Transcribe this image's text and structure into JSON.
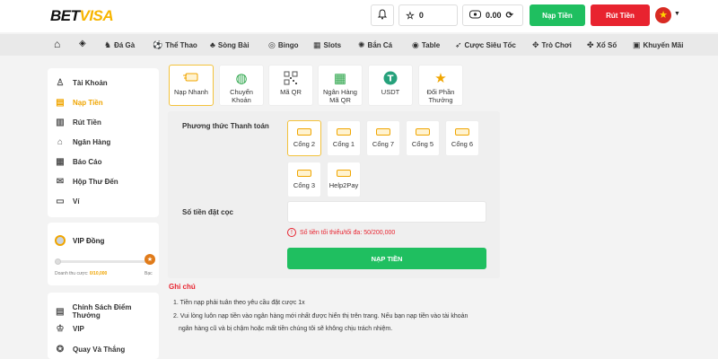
{
  "header": {
    "logo_part1": "BET",
    "logo_part2": "VISA",
    "points": "0",
    "balance": "0.00",
    "deposit_label": "Nạp Tiền",
    "withdraw_label": "Rút Tiền",
    "flag_star": "★",
    "brand_colors": {
      "deposit": "#1fbf60",
      "withdraw": "#e8232f",
      "accent": "#f0a500"
    }
  },
  "nav": {
    "items": [
      {
        "label": "Đá Gà",
        "icon": "rooster-icon"
      },
      {
        "label": "Thể Thao",
        "icon": "soccer-ball-icon"
      },
      {
        "label": "Sòng Bài",
        "icon": "casino-chip-icon"
      },
      {
        "label": "Bingo",
        "icon": "bingo-icon"
      },
      {
        "label": "Slots",
        "icon": "slot-machine-icon"
      },
      {
        "label": "Bắn Cá",
        "icon": "fish-icon"
      },
      {
        "label": "Table",
        "icon": "table-icon"
      },
      {
        "label": "Cược Siêu Tốc",
        "icon": "fast-bet-icon"
      },
      {
        "label": "Trò Chơi",
        "icon": "gamepad-icon"
      },
      {
        "label": "Xổ Số",
        "icon": "lottery-icon"
      },
      {
        "label": "Khuyến Mãi",
        "icon": "gift-icon"
      }
    ]
  },
  "sidebar": {
    "account": [
      {
        "label": "Tài Khoản",
        "icon": "user-icon"
      },
      {
        "label": "Nạp Tiền",
        "icon": "deposit-icon",
        "active": true
      },
      {
        "label": "Rút Tiền",
        "icon": "withdraw-icon"
      },
      {
        "label": "Ngân Hàng",
        "icon": "bank-icon"
      },
      {
        "label": "Báo Cáo",
        "icon": "report-icon"
      },
      {
        "label": "Hộp Thư Đến",
        "icon": "mail-icon"
      },
      {
        "label": "Ví",
        "icon": "wallet-icon"
      }
    ],
    "vip": {
      "title": "VIP Đồng",
      "turnover_label": "Doanh thu cược:",
      "turnover_value": "0/10,000",
      "next_level": "Bạc",
      "progress": 0
    },
    "more": [
      {
        "label": "Chính Sách Điểm Thưởng",
        "icon": "policy-icon"
      },
      {
        "label": "VIP",
        "icon": "crown-icon"
      },
      {
        "label": "Quay Và Thắng",
        "icon": "spin-icon"
      }
    ]
  },
  "methods": [
    {
      "label": "Nạp Nhanh",
      "icon": "card-icon",
      "active": true
    },
    {
      "label": "Chuyển Khoản",
      "icon": "globe-icon"
    },
    {
      "label": "Mã QR",
      "icon": "qr-icon"
    },
    {
      "label": "Ngân Hàng Mã QR",
      "icon": "bank-qr-icon"
    },
    {
      "label": "USDT",
      "icon": "usdt-icon"
    },
    {
      "label": "Đổi Phần Thưởng",
      "icon": "star-icon"
    }
  ],
  "form": {
    "payment_label": "Phương thức Thanh toán",
    "gates": [
      {
        "label": "Cổng 2",
        "active": true
      },
      {
        "label": "Cổng 1"
      },
      {
        "label": "Cổng 7"
      },
      {
        "label": "Cổng 5"
      },
      {
        "label": "Cổng 6"
      },
      {
        "label": "Cổng 3"
      },
      {
        "label": "Help2Pay"
      }
    ],
    "amount_label": "Số tiền đặt cọc",
    "amount_value": "",
    "error_text": "Số tiền tối thiểu/tối đa: 50/200,000",
    "submit_label": "NẠP TIỀN"
  },
  "notes": {
    "title": "Ghi chú",
    "items": [
      "1. Tiền nạp phải tuân theo yêu cầu đặt cược 1x",
      "2. Vui lòng luôn nạp tiền vào ngân hàng mới nhất được hiển thị trên trang. Nếu bạn nạp tiền vào tài khoản",
      "ngân hàng cũ và bị chậm hoặc mất tiền chúng tôi sẽ không chịu trách nhiệm."
    ]
  }
}
